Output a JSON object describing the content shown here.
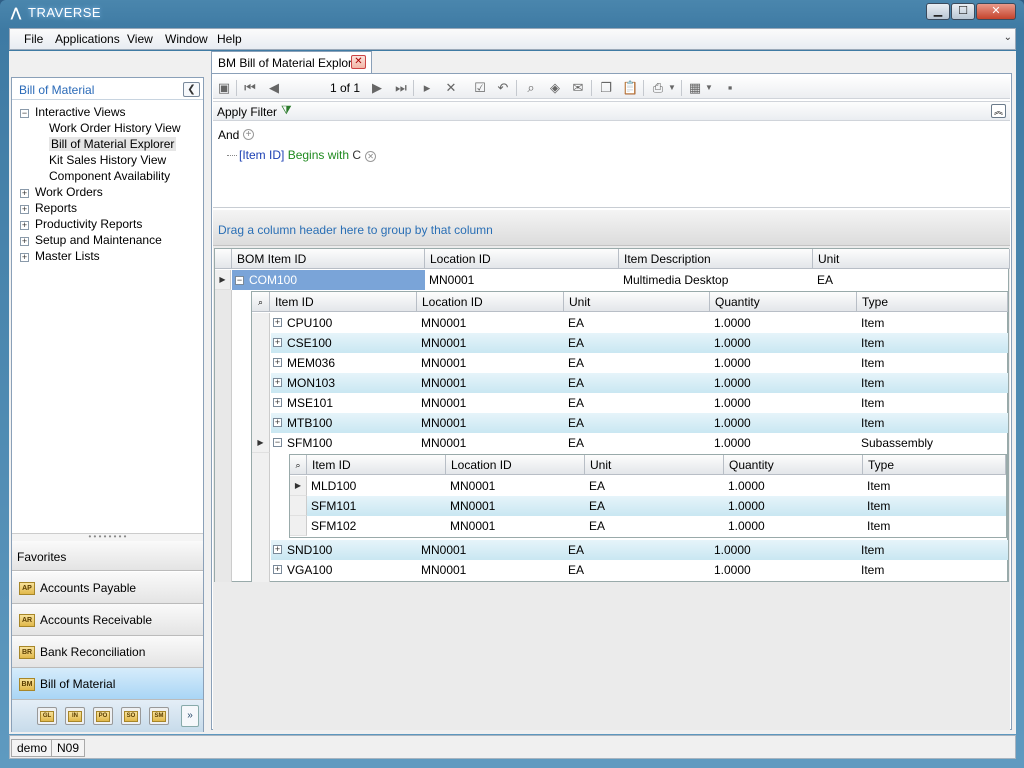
{
  "window": {
    "title": "TRAVERSE",
    "minimize_label": "▁",
    "maximize_label": "☐",
    "close_label": "✕"
  },
  "menu": [
    "File",
    "Applications",
    "View",
    "Window",
    "Help"
  ],
  "left_pane": {
    "title": "Bill of Material",
    "tree": [
      {
        "label": "Interactive Views",
        "expanded": true,
        "children": [
          "Work Order History View",
          "Bill of Material Explorer",
          "Kit Sales History View",
          "Component Availability"
        ],
        "selected_child": 1
      },
      {
        "label": "Work Orders",
        "expanded": false
      },
      {
        "label": "Reports",
        "expanded": false
      },
      {
        "label": "Productivity Reports",
        "expanded": false
      },
      {
        "label": "Setup and Maintenance",
        "expanded": false
      },
      {
        "label": "Master Lists",
        "expanded": false
      }
    ],
    "favorites_label": "Favorites",
    "nav_buttons": [
      {
        "label": "Accounts Payable",
        "code": "AP"
      },
      {
        "label": "Accounts Receivable",
        "code": "AR"
      },
      {
        "label": "Bank Reconciliation",
        "code": "BR"
      },
      {
        "label": "Bill of Material",
        "code": "BM",
        "active": true
      }
    ],
    "small_icons": [
      "GL",
      "IN",
      "PO",
      "SO",
      "SM"
    ]
  },
  "document": {
    "tab_label": "BM Bill of Material Explorer",
    "pager": "1 of 1",
    "filter": {
      "apply_label": "Apply Filter",
      "root_op": "And",
      "condition": {
        "field": "[Item ID]",
        "operator": "Begins with",
        "value": "C"
      }
    },
    "group_panel_text": "Drag a column header here to group by that column",
    "master_columns": [
      "BOM Item ID",
      "Location ID",
      "Item Description",
      "Unit"
    ],
    "master_row": {
      "bom_item_id": "COM100",
      "location_id": "MN0001",
      "description": "Multimedia Desktop",
      "unit": "EA"
    },
    "detail_columns": [
      "Item ID",
      "Location ID",
      "Unit",
      "Quantity",
      "Type"
    ],
    "detail_rows": [
      {
        "item_id": "CPU100",
        "location_id": "MN0001",
        "unit": "EA",
        "quantity": "1.0000",
        "type": "Item"
      },
      {
        "item_id": "CSE100",
        "location_id": "MN0001",
        "unit": "EA",
        "quantity": "1.0000",
        "type": "Item"
      },
      {
        "item_id": "MEM036",
        "location_id": "MN0001",
        "unit": "EA",
        "quantity": "1.0000",
        "type": "Item"
      },
      {
        "item_id": "MON103",
        "location_id": "MN0001",
        "unit": "EA",
        "quantity": "1.0000",
        "type": "Item"
      },
      {
        "item_id": "MSE101",
        "location_id": "MN0001",
        "unit": "EA",
        "quantity": "1.0000",
        "type": "Item"
      },
      {
        "item_id": "MTB100",
        "location_id": "MN0001",
        "unit": "EA",
        "quantity": "1.0000",
        "type": "Item"
      },
      {
        "item_id": "SFM100",
        "location_id": "MN0001",
        "unit": "EA",
        "quantity": "1.0000",
        "type": "Subassembly"
      }
    ],
    "sub_columns": [
      "Item ID",
      "Location ID",
      "Unit",
      "Quantity",
      "Type"
    ],
    "sub_rows": [
      {
        "item_id": "MLD100",
        "location_id": "MN0001",
        "unit": "EA",
        "quantity": "1.0000",
        "type": "Item"
      },
      {
        "item_id": "SFM101",
        "location_id": "MN0001",
        "unit": "EA",
        "quantity": "1.0000",
        "type": "Item"
      },
      {
        "item_id": "SFM102",
        "location_id": "MN0001",
        "unit": "EA",
        "quantity": "1.0000",
        "type": "Item"
      }
    ],
    "detail_rows_after": [
      {
        "item_id": "SND100",
        "location_id": "MN0001",
        "unit": "EA",
        "quantity": "1.0000",
        "type": "Item"
      },
      {
        "item_id": "VGA100",
        "location_id": "MN0001",
        "unit": "EA",
        "quantity": "1.0000",
        "type": "Item"
      }
    ]
  },
  "status": [
    "demo",
    "N09"
  ],
  "colors": {
    "accent": "#2a6ab8",
    "selected_row": "#7aa4d8",
    "alt_row": "#d3ecf5"
  }
}
